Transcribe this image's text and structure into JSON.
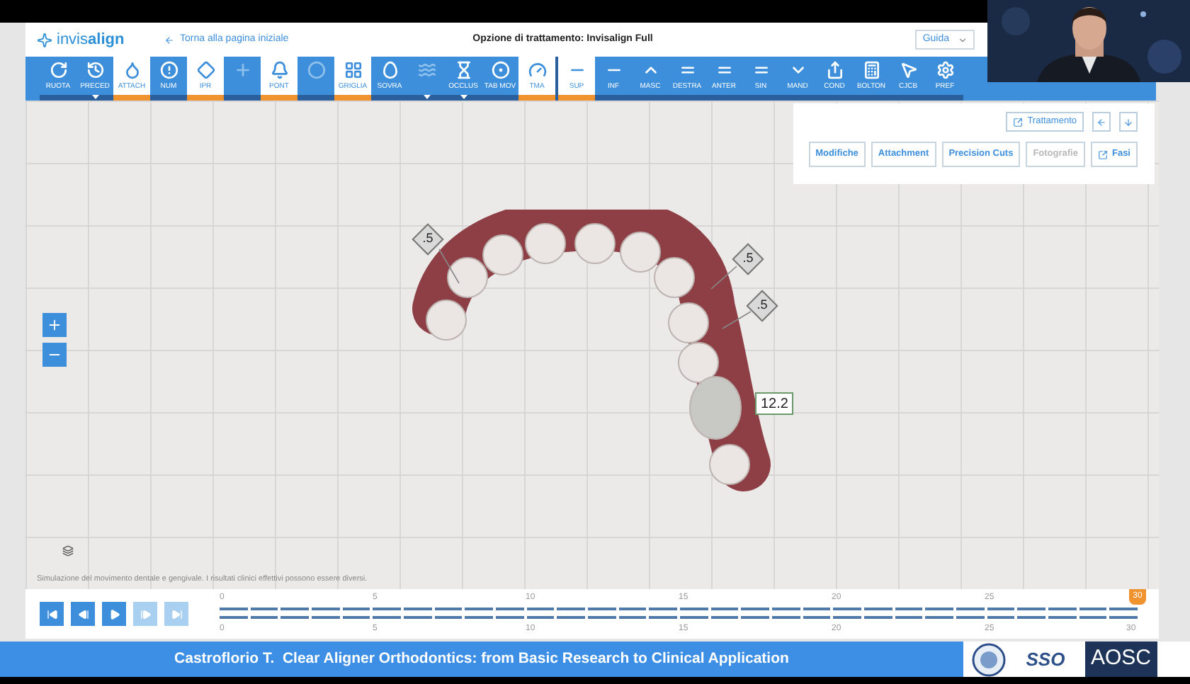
{
  "header": {
    "logo": "invis**align**",
    "back_link": "Torna alla pagina iniziale",
    "title": "Opzione di trattamento: Invisalign Full",
    "help_menu": "Guida"
  },
  "toolbar_groups": [
    [
      {
        "label": "RUOTA",
        "selected": false,
        "disabled": false,
        "dropdown": false
      },
      {
        "label": "PRECED",
        "selected": false,
        "disabled": false,
        "dropdown": true
      },
      {
        "label": "ATTACH",
        "selected": true,
        "disabled": false,
        "dropdown": false
      },
      {
        "label": "NUM",
        "selected": false,
        "disabled": false,
        "dropdown": false
      },
      {
        "label": "IPR",
        "selected": true,
        "disabled": false,
        "dropdown": false
      },
      {
        "selected": false,
        "disabled": true,
        "dropdown": false
      },
      {
        "label": "PONT",
        "selected": true,
        "disabled": false,
        "dropdown": false
      },
      {
        "selected": false,
        "disabled": true,
        "dropdown": false
      },
      {
        "label": "GRIGLIA",
        "selected": true,
        "disabled": false,
        "dropdown": false
      },
      {
        "label": "SOVRA",
        "selected": false,
        "disabled": false,
        "dropdown": false
      },
      {
        "selected": false,
        "disabled": true,
        "dropdown": true
      },
      {
        "label": "OCCLUS",
        "selected": false,
        "disabled": false,
        "dropdown": true
      },
      {
        "label": "TAB MOV",
        "selected": false,
        "disabled": false,
        "dropdown": false
      },
      {
        "label": "TMA",
        "selected": true,
        "disabled": false,
        "dropdown": false
      }
    ],
    [
      {
        "label": "SUP",
        "selected": true,
        "disabled": false,
        "dropdown": false
      },
      {
        "label": "INF",
        "selected": false,
        "disabled": false,
        "dropdown": false
      },
      {
        "label": "MASC",
        "selected": false,
        "disabled": false,
        "dropdown": false
      },
      {
        "label": "DESTRA",
        "selected": false,
        "disabled": false,
        "dropdown": false
      },
      {
        "label": "ANTER",
        "selected": false,
        "disabled": false,
        "dropdown": false
      },
      {
        "label": "SIN",
        "selected": false,
        "disabled": false,
        "dropdown": false
      },
      {
        "label": "MAND",
        "selected": false,
        "disabled": false,
        "dropdown": false
      },
      {
        "label": "COND",
        "selected": false,
        "disabled": false,
        "dropdown": false
      },
      {
        "label": "BOLTON",
        "selected": false,
        "disabled": false,
        "dropdown": false
      },
      {
        "label": "CJCB",
        "selected": false,
        "disabled": false,
        "dropdown": false
      },
      {
        "label": "PREF",
        "selected": false,
        "disabled": false,
        "dropdown": false
      }
    ]
  ],
  "panel": {
    "treatment_button": "Trattamento",
    "buttons": [
      {
        "label": "Modifiche",
        "disabled": false,
        "kind": "plain"
      },
      {
        "label": "Attachment",
        "disabled": false,
        "kind": "plain"
      },
      {
        "label": "Precision Cuts",
        "disabled": false,
        "kind": "plain"
      },
      {
        "label": "Fotografie",
        "disabled": true,
        "kind": "plain"
      },
      {
        "label": "Fasi",
        "disabled": false,
        "kind": "link"
      }
    ]
  },
  "ipr_labels": [
    ".5",
    ".5",
    ".5"
  ],
  "tooth_size": "12.2",
  "disclaimer": "Simulazione del movimento dentale e gengivale. I risultati clinici effettivi possono essere diversi.",
  "playback": [
    {
      "disabled": false
    },
    {
      "disabled": false
    },
    {
      "disabled": false
    },
    {
      "disabled": true
    },
    {
      "disabled": true
    }
  ],
  "timeline": {
    "top_ticks": [
      "0",
      "5",
      "10",
      "15",
      "20",
      "25"
    ],
    "bottom_ticks": [
      "0",
      "5",
      "10",
      "15",
      "20",
      "25",
      "30"
    ],
    "current": "30"
  },
  "footer": {
    "title": "Castroflorio T.  Clear Aligner Orthodontics: from Basic Research to Clinical Application",
    "logos": [
      "SSO",
      "AOSC"
    ]
  }
}
